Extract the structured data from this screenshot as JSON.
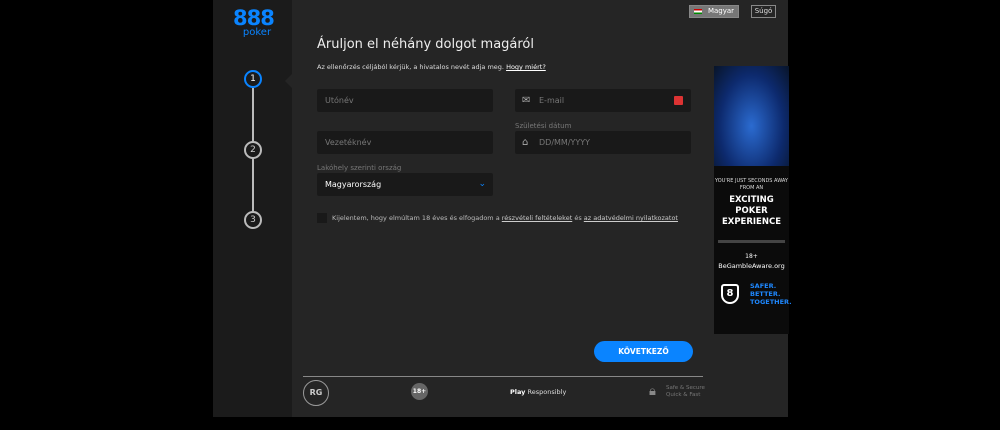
{
  "header": {
    "logo_number": "888",
    "logo_word": "poker",
    "language": "Magyar",
    "help": "Súgó"
  },
  "steps": [
    "1",
    "2",
    "3"
  ],
  "form": {
    "title": "Áruljon el néhány dolgot magáról",
    "subtitle": "Az ellenőrzés céljából kérjük, a hivatalos nevét adja meg.",
    "why_link": "Hogy miért?",
    "first_name_placeholder": "Utónév",
    "email_placeholder": "E-mail",
    "last_name_placeholder": "Vezetéknév",
    "dob_label": "Születési dátum",
    "dob_placeholder": "DD/MM/YYYY",
    "country_label": "Lakóhely szerinti ország",
    "country_value": "Magyarország",
    "terms_text": "Kijelentem, hogy elmúltam 18 éves és elfogadom a",
    "terms_link": "részvételi feltételeket",
    "terms_and": "és",
    "privacy_link": "az adatvédelmi nyilatkozatot",
    "next_button": "KÖVETKEZŐ"
  },
  "footer": {
    "rg": "RG",
    "age": "18+",
    "play": "Play",
    "responsibly": "Responsibly",
    "safe1": "Safe & Secure",
    "safe2": "Quick & Fast"
  },
  "ad": {
    "line1": "YOU'RE JUST SECONDS AWAY FROM AN",
    "line2": "EXCITING POKER EXPERIENCE",
    "bga_age": "18+",
    "bga": "BeGambleAware.org",
    "shield": "8",
    "slogan1": "SAFER.",
    "slogan2": "BETTER.",
    "slogan3": "TOGETHER."
  },
  "colors": {
    "accent": "#0a84ff",
    "background": "#252525"
  }
}
